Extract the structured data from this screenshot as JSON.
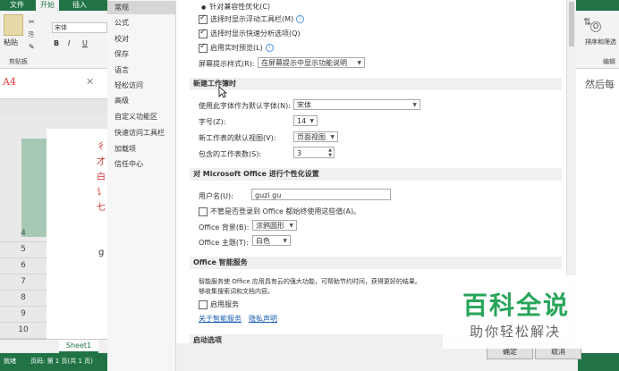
{
  "excel": {
    "tabs": [
      "文件",
      "开始",
      "插入"
    ],
    "clipboard_label": "剪贴板",
    "paste_label": "粘贴",
    "font_name": "宋体",
    "font_buttons": [
      "B",
      "I",
      "U"
    ],
    "name_box": "A4",
    "formula_tail": "然后每",
    "row_numbers": [
      "4",
      "5",
      "6",
      "7",
      "8",
      "9",
      "10"
    ],
    "red_cell_chars": [
      "彳",
      "才",
      "白",
      "讠",
      "七"
    ],
    "cell_g": "g",
    "sheet_tab": "Sheet1",
    "status_ready": "就绪",
    "status_page": "页码: 第 1 页(共 1 页)",
    "right_ribbon": {
      "sort_label": "排序和筛选",
      "edit_label": "编辑",
      "o_button": "O"
    }
  },
  "dialog": {
    "nav_items": [
      "常规",
      "公式",
      "校对",
      "保存",
      "语言",
      "轻松访问",
      "高级",
      "自定义功能区",
      "快速访问工具栏",
      "加载项",
      "信任中心"
    ],
    "active_nav": "常规",
    "top_options": [
      {
        "label": "针对兼容性优化(C)",
        "checked": false,
        "radio": true
      },
      {
        "label": "选择时显示浮动工具栏(M)",
        "checked": true,
        "info": true
      },
      {
        "label": "选择时显示快速分析选项(Q)",
        "checked": true
      },
      {
        "label": "启用实时预览(L)",
        "checked": true,
        "info": true
      }
    ],
    "screentip": {
      "label": "屏幕提示样式(R):",
      "value": "在屏幕提示中显示功能说明"
    },
    "new_workbook": {
      "heading": "新建工作簿时",
      "font_label": "使用此字体作为默认字体(N):",
      "font_value": "宋体",
      "size_label": "字号(Z):",
      "size_value": "14",
      "view_label": "新工作表的默认视图(V):",
      "view_value": "页面视图",
      "sheets_label": "包含的工作表数(S):",
      "sheets_value": "3"
    },
    "personalize": {
      "heading": "对 Microsoft Office 进行个性化设置",
      "username_label": "用户名(U):",
      "username_value": "guzi gu",
      "always_use_label": "不管是否登录到 Office 都始终使用这些值(A)。",
      "always_use_checked": false,
      "background_label": "Office 背景(B):",
      "background_value": "涂鸦圆形",
      "theme_label": "Office 主题(T):",
      "theme_value": "白色"
    },
    "intelligent": {
      "heading": "Office 智能服务",
      "description_1": "智能服务使 Office 应用具有云的强大功能，可帮助节约时间，获得更好的结果。",
      "description_2": "够收集搜索词和文档内容。",
      "enable_label": "启用服务",
      "enable_checked": false,
      "link_about": "关于智能服务",
      "link_privacy": "隐私声明"
    },
    "partial_heading": "启动选项",
    "ok_button": "确定",
    "cancel_button": "取消"
  },
  "watermark": {
    "title": "百科全说",
    "subtitle": "助你轻松解决"
  },
  "colors": {
    "excel_green": "#217346",
    "watermark_green": "#27a55a",
    "red_text": "#d32f2f",
    "link_blue": "#1a5fb4"
  }
}
